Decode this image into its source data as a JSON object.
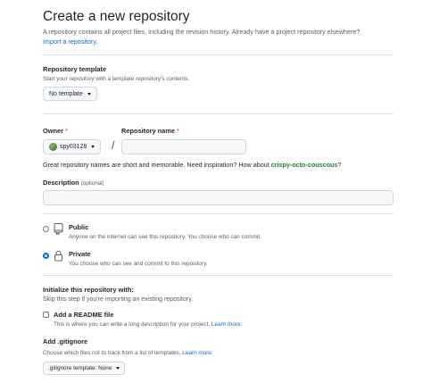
{
  "header": {
    "title": "Create a new repository",
    "subtitle": "A repository contains all project files, including the revision history. Already have a project repository elsewhere?",
    "import_link": "Import a repository."
  },
  "template": {
    "label": "Repository template",
    "hint": "Start your repository with a template repository's contents.",
    "button": "No template"
  },
  "owner": {
    "label": "Owner",
    "required": "*",
    "value": "spy03128"
  },
  "repo_name": {
    "label": "Repository name",
    "required": "*",
    "value": ""
  },
  "separator": "/",
  "name_hint": {
    "text": "Great repository names are short and memorable. Need inspiration? How about ",
    "suggestion": "crispy-octo-couscous",
    "end": "?"
  },
  "description": {
    "label": "Description",
    "optional": "(optional)",
    "value": ""
  },
  "visibility": {
    "public": {
      "label": "Public",
      "desc": "Anyone on the internet can see this repository. You choose who can commit.",
      "checked": false
    },
    "private": {
      "label": "Private",
      "desc": "You choose who can see and commit to this repository.",
      "checked": true
    }
  },
  "init": {
    "heading": "Initialize this repository with:",
    "hint": "Skip this step if you're importing an existing repository.",
    "readme_label": "Add a README file",
    "readme_desc": "This is where you can write a long description for your project.",
    "readme_link": "Learn more."
  },
  "gitignore": {
    "label": "Add .gitignore",
    "hint": "Choose which files not to track from a list of templates.",
    "link": "Learn more.",
    "button": ".gitignore template: None"
  }
}
